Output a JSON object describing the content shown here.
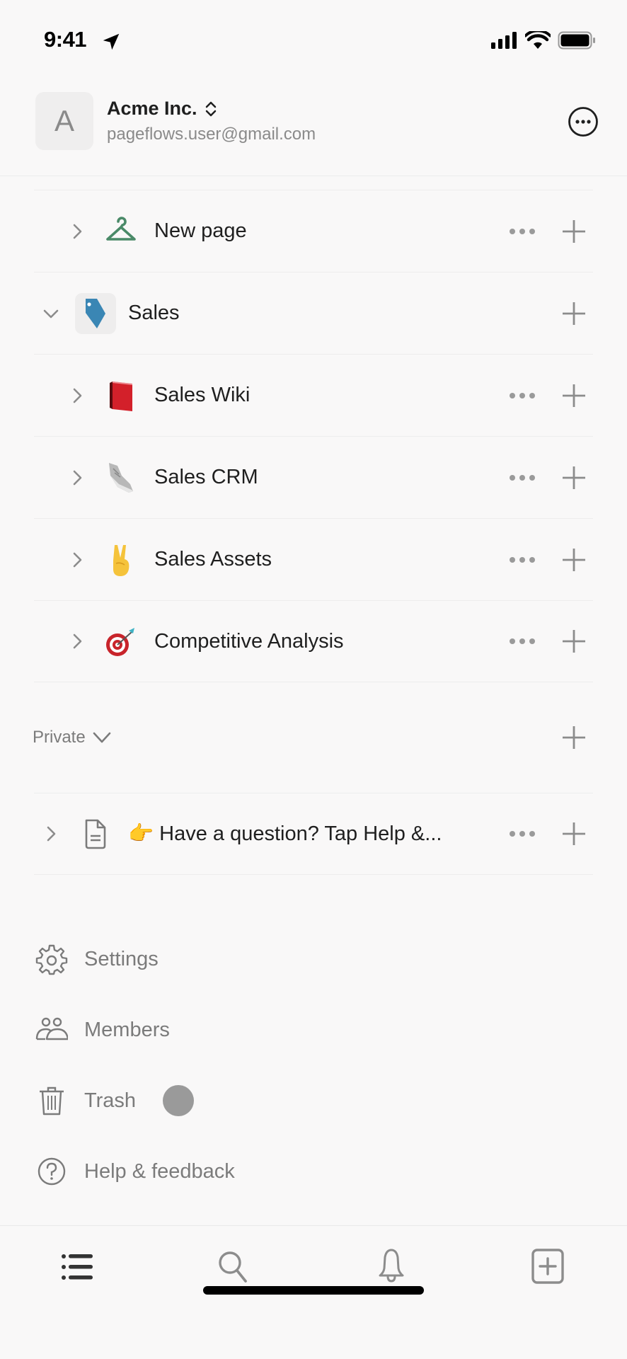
{
  "status_bar": {
    "time": "9:41"
  },
  "workspace": {
    "avatar_letter": "A",
    "name": "Acme Inc.",
    "email": "pageflows.user@gmail.com"
  },
  "tree": {
    "items": [
      {
        "label": "New page",
        "icon": "hanger-icon",
        "expanded": false,
        "depth": 1
      },
      {
        "label": "Sales",
        "icon": "tag-icon",
        "expanded": true,
        "depth": 0
      },
      {
        "label": "Sales Wiki",
        "icon": "book-icon",
        "emoji": "📕",
        "expanded": false,
        "depth": 1
      },
      {
        "label": "Sales CRM",
        "icon": "sneaker-icon",
        "emoji": "👟",
        "expanded": false,
        "depth": 1
      },
      {
        "label": "Sales Assets",
        "icon": "victory-hand-icon",
        "emoji": "✌️",
        "expanded": false,
        "depth": 1
      },
      {
        "label": "Competitive Analysis",
        "icon": "target-icon",
        "emoji": "🎯",
        "expanded": false,
        "depth": 1
      }
    ]
  },
  "private": {
    "section_label": "Private",
    "items": [
      {
        "label": "👉 Have a question? Tap Help &...",
        "icon": "document-icon",
        "expanded": false
      }
    ]
  },
  "menu": {
    "items": [
      {
        "label": "Settings",
        "icon": "gear-icon"
      },
      {
        "label": "Members",
        "icon": "members-icon"
      },
      {
        "label": "Trash",
        "icon": "trash-icon"
      },
      {
        "label": "Help & feedback",
        "icon": "help-icon"
      }
    ]
  },
  "tabbar": {
    "tabs": [
      {
        "name": "sidebar",
        "icon": "list-icon",
        "active": true
      },
      {
        "name": "search",
        "icon": "search-icon",
        "active": false
      },
      {
        "name": "notifications",
        "icon": "bell-icon",
        "active": false
      },
      {
        "name": "new-page",
        "icon": "new-page-icon",
        "active": false
      }
    ]
  },
  "colors": {
    "background": "#f9f8f8",
    "text_primary": "#1f1f1f",
    "text_secondary": "#7b7b7b",
    "icon_gray": "#8c8c8c",
    "hanger_green": "#4a8a68",
    "tag_blue": "#3a86b4",
    "divider": "#ededed"
  }
}
